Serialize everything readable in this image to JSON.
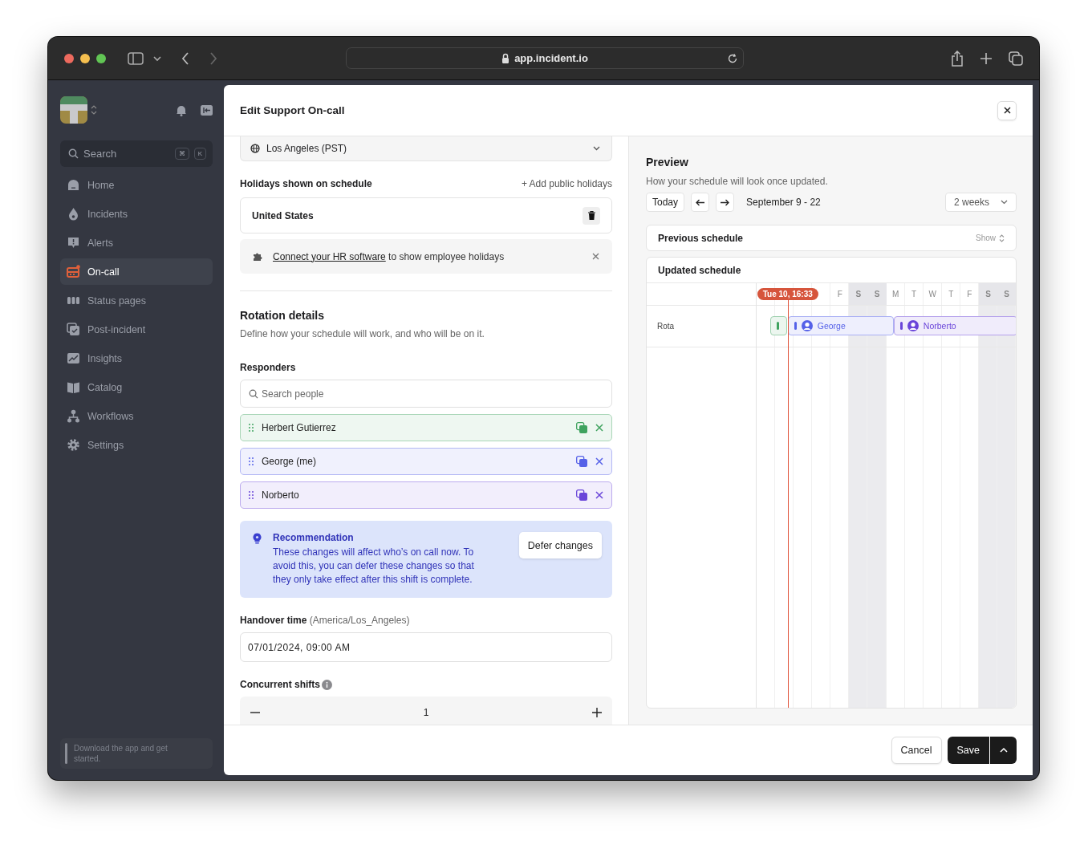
{
  "browser": {
    "url": "app.incident.io"
  },
  "sidebar": {
    "search": {
      "placeholder": "Search",
      "keys": [
        "⌘",
        "K"
      ]
    },
    "items": [
      {
        "label": "Home",
        "selected": false
      },
      {
        "label": "Incidents",
        "selected": false
      },
      {
        "label": "Alerts",
        "selected": false
      },
      {
        "label": "On-call",
        "selected": true
      },
      {
        "label": "Status pages",
        "selected": false
      },
      {
        "label": "Post-incident",
        "selected": false
      },
      {
        "label": "Insights",
        "selected": false
      },
      {
        "label": "Catalog",
        "selected": false
      },
      {
        "label": "Workflows",
        "selected": false
      },
      {
        "label": "Settings",
        "selected": false
      }
    ],
    "footer": "Download the app and get started."
  },
  "modal": {
    "title": "Edit Support On-call",
    "form": {
      "timezone": "Los Angeles (PST)",
      "holidays": {
        "label": "Holidays shown on schedule",
        "add_link": "+ Add public holidays",
        "countries": [
          "United States"
        ],
        "hr_link": "Connect your HR software",
        "hr_text": " to show employee holidays"
      },
      "rotation": {
        "title": "Rotation details",
        "description": "Define how your schedule will work, and who will be on it."
      },
      "responders": {
        "label": "Responders",
        "placeholder": "Search people",
        "people": [
          {
            "name": "Herbert Gutierrez",
            "color": "#3fa35f"
          },
          {
            "name": "George (me)",
            "color": "#5561e8"
          },
          {
            "name": "Norberto",
            "color": "#6a45d9"
          }
        ]
      },
      "recommendation": {
        "title": "Recommendation",
        "text": "These changes will affect who’s on call now. To avoid this, you can defer these changes so that they only take effect after this shift is complete.",
        "button": "Defer changes"
      },
      "handover": {
        "label": "Handover time",
        "hint": "(America/Los_Angeles)",
        "value": "07/01/2024, 09:00 AM"
      },
      "concurrent": {
        "label": "Concurrent shifts",
        "value": "1"
      }
    },
    "preview": {
      "title": "Preview",
      "description": "How your schedule will look once updated.",
      "today": "Today",
      "range": "September 9 - 22",
      "period": "2 weeks",
      "previous": {
        "title": "Previous schedule",
        "toggle": "Show"
      },
      "updated": {
        "title": "Updated schedule",
        "now": "Tue 10, 16:33",
        "days": [
          {
            "label": "F",
            "weekend": false
          },
          {
            "label": "S",
            "weekend": true
          },
          {
            "label": "S",
            "weekend": true
          },
          {
            "label": "M",
            "weekend": false
          },
          {
            "label": "T",
            "weekend": false
          },
          {
            "label": "W",
            "weekend": false
          },
          {
            "label": "T",
            "weekend": false
          },
          {
            "label": "F",
            "weekend": false
          },
          {
            "label": "S",
            "weekend": true
          },
          {
            "label": "S",
            "weekend": true
          }
        ],
        "rows": [
          {
            "label": "Rota",
            "shifts": [
              {
                "kind": "stub",
                "color": "#3fa35f"
              },
              {
                "kind": "person",
                "name": "George",
                "color": "#5561e8"
              },
              {
                "kind": "person",
                "name": "Norberto",
                "color": "#6a45d9"
              }
            ]
          }
        ]
      }
    },
    "footer": {
      "cancel": "Cancel",
      "save": "Save"
    }
  }
}
